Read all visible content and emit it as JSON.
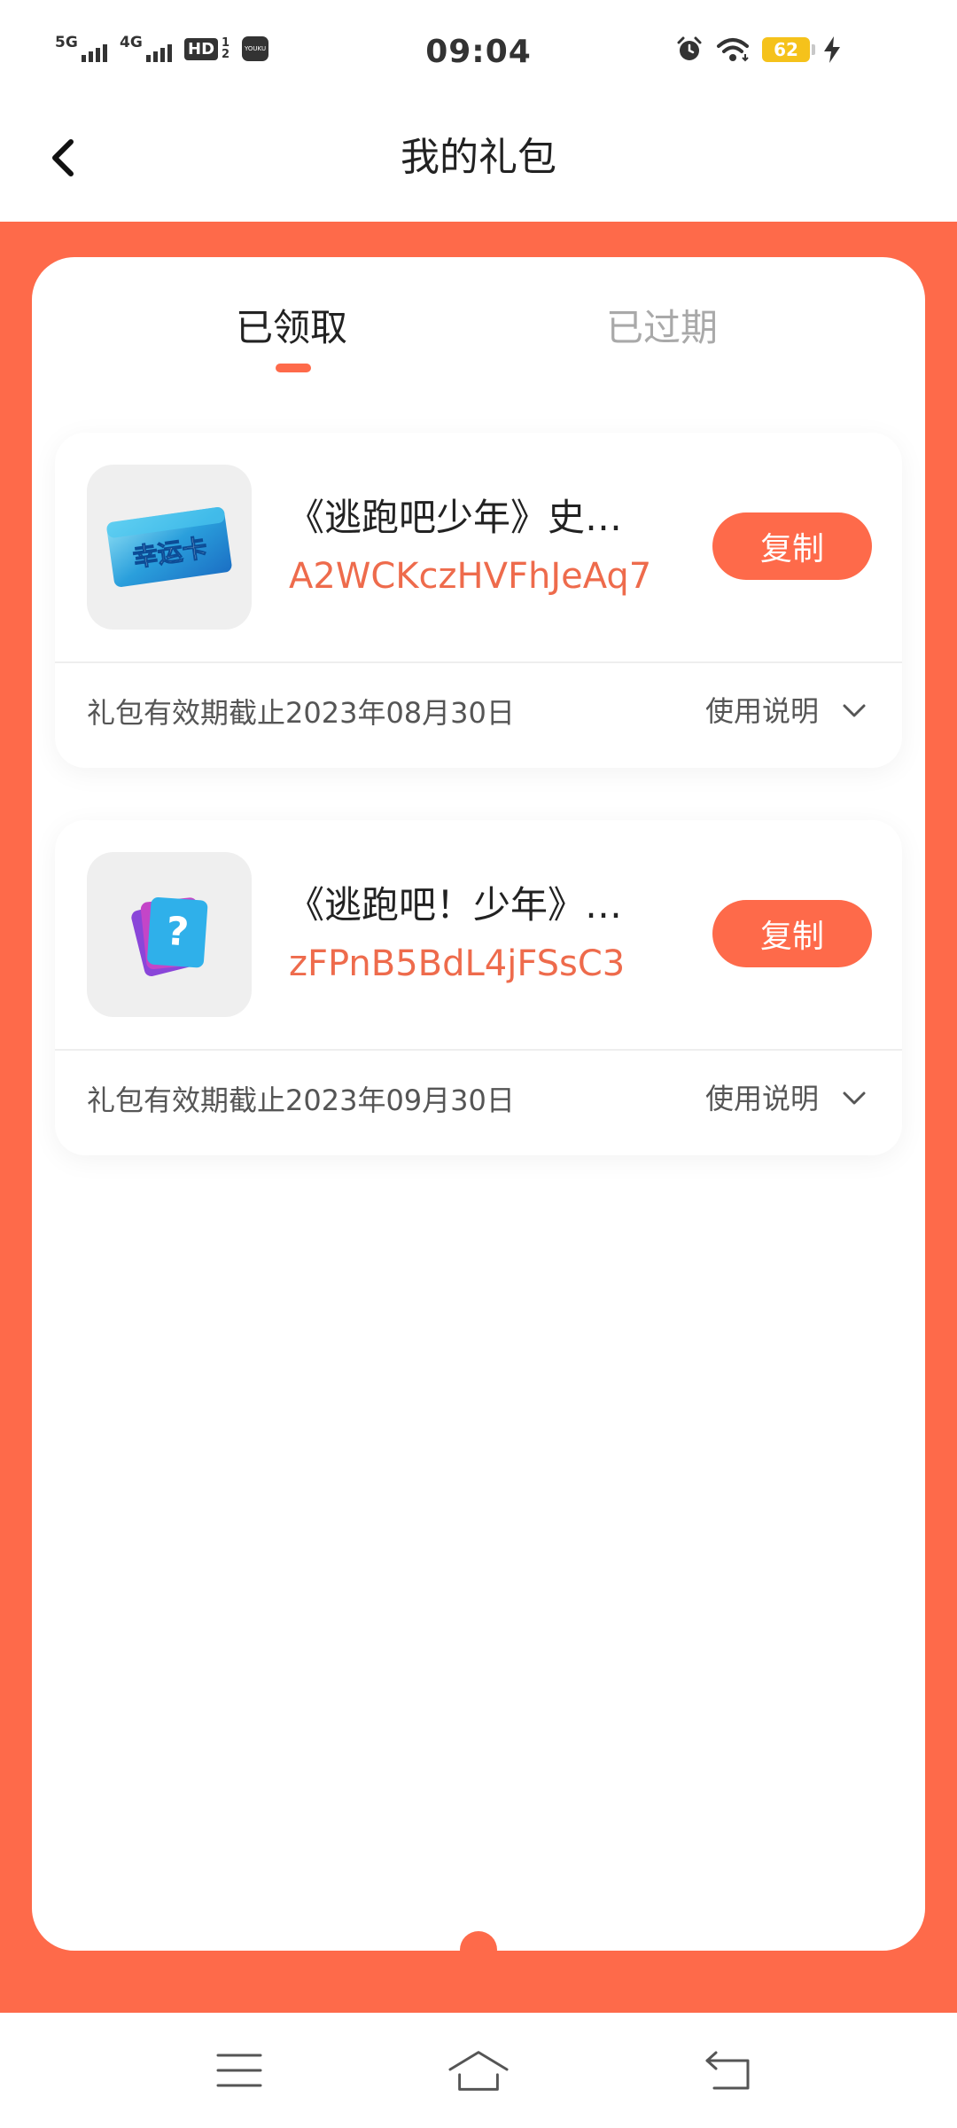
{
  "status_bar": {
    "time": "09:04",
    "signal_1": "5G",
    "signal_2": "4G",
    "hd_label": "HD",
    "hd_sim_top": "1",
    "hd_sim_bottom": "2",
    "app_icon_label": "YOUKU",
    "battery": "62"
  },
  "header": {
    "title": "我的礼包",
    "back_icon": "chevron-left-icon"
  },
  "tabs": {
    "claimed": "已领取",
    "expired": "已过期",
    "active": "claimed"
  },
  "gifts": [
    {
      "thumb_text": "幸运卡",
      "name": "《逃跑吧少年》史…",
      "code": "A2WCKczHVFhJeAq7",
      "copy_label": "复制",
      "expiry": "礼包有效期截止2023年08月30日",
      "usage_label": "使用说明"
    },
    {
      "thumb_text": "?",
      "name": "《逃跑吧！少年》…",
      "code": "zFPnB5BdL4jFSsC3",
      "copy_label": "复制",
      "expiry": "礼包有效期截止2023年09月30日",
      "usage_label": "使用说明"
    }
  ],
  "colors": {
    "accent": "#fe6a4a",
    "code_text": "#ee6b4c",
    "battery": "#f5c21b"
  }
}
